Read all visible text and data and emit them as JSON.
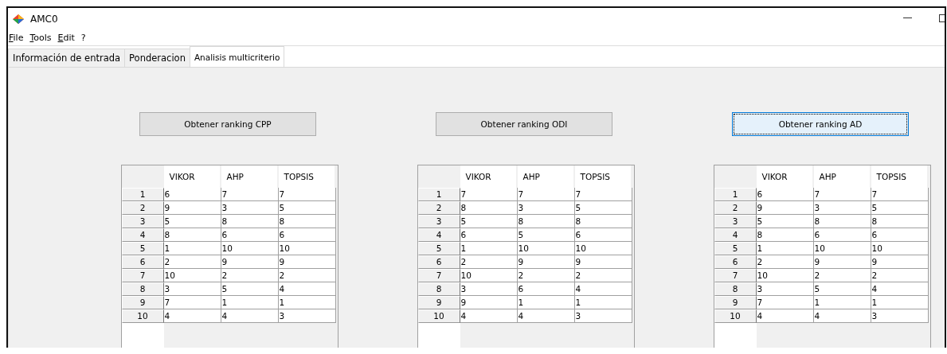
{
  "window": {
    "title": "AMC0"
  },
  "menu": [
    "File",
    "Tools",
    "Edit",
    "?"
  ],
  "tabs": [
    {
      "label": "Información de entrada",
      "selected": false
    },
    {
      "label": "Ponderacion",
      "selected": false
    },
    {
      "label": "Analisis multicriterio",
      "selected": true
    }
  ],
  "panels": [
    {
      "button": {
        "label": "Obtener ranking CPP",
        "focused": false
      },
      "table": {
        "columns": [
          "VIKOR",
          "AHP",
          "TOPSIS"
        ],
        "rows": [
          {
            "header": "1",
            "cells": [
              "6",
              "7",
              "7"
            ]
          },
          {
            "header": "2",
            "cells": [
              "9",
              "3",
              "5"
            ]
          },
          {
            "header": "3",
            "cells": [
              "5",
              "8",
              "8"
            ]
          },
          {
            "header": "4",
            "cells": [
              "8",
              "6",
              "6"
            ]
          },
          {
            "header": "5",
            "cells": [
              "1",
              "10",
              "10"
            ]
          },
          {
            "header": "6",
            "cells": [
              "2",
              "9",
              "9"
            ]
          },
          {
            "header": "7",
            "cells": [
              "10",
              "2",
              "2"
            ]
          },
          {
            "header": "8",
            "cells": [
              "3",
              "5",
              "4"
            ]
          },
          {
            "header": "9",
            "cells": [
              "7",
              "1",
              "1"
            ]
          },
          {
            "header": "10",
            "cells": [
              "4",
              "4",
              "3"
            ]
          }
        ]
      }
    },
    {
      "button": {
        "label": "Obtener ranking ODI",
        "focused": false
      },
      "table": {
        "columns": [
          "VIKOR",
          "AHP",
          "TOPSIS"
        ],
        "rows": [
          {
            "header": "1",
            "cells": [
              "7",
              "7",
              "7"
            ]
          },
          {
            "header": "2",
            "cells": [
              "8",
              "3",
              "5"
            ]
          },
          {
            "header": "3",
            "cells": [
              "5",
              "8",
              "8"
            ]
          },
          {
            "header": "4",
            "cells": [
              "6",
              "5",
              "6"
            ]
          },
          {
            "header": "5",
            "cells": [
              "1",
              "10",
              "10"
            ]
          },
          {
            "header": "6",
            "cells": [
              "2",
              "9",
              "9"
            ]
          },
          {
            "header": "7",
            "cells": [
              "10",
              "2",
              "2"
            ]
          },
          {
            "header": "8",
            "cells": [
              "3",
              "6",
              "4"
            ]
          },
          {
            "header": "9",
            "cells": [
              "9",
              "1",
              "1"
            ]
          },
          {
            "header": "10",
            "cells": [
              "4",
              "4",
              "3"
            ]
          }
        ]
      }
    },
    {
      "button": {
        "label": "Obtener ranking AD",
        "focused": true
      },
      "table": {
        "columns": [
          "VIKOR",
          "AHP",
          "TOPSIS"
        ],
        "rows": [
          {
            "header": "1",
            "cells": [
              "6",
              "7",
              "7"
            ]
          },
          {
            "header": "2",
            "cells": [
              "9",
              "3",
              "5"
            ]
          },
          {
            "header": "3",
            "cells": [
              "5",
              "8",
              "8"
            ]
          },
          {
            "header": "4",
            "cells": [
              "8",
              "6",
              "6"
            ]
          },
          {
            "header": "5",
            "cells": [
              "1",
              "10",
              "10"
            ]
          },
          {
            "header": "6",
            "cells": [
              "2",
              "9",
              "9"
            ]
          },
          {
            "header": "7",
            "cells": [
              "10",
              "2",
              "2"
            ]
          },
          {
            "header": "8",
            "cells": [
              "3",
              "5",
              "4"
            ]
          },
          {
            "header": "9",
            "cells": [
              "7",
              "1",
              "1"
            ]
          },
          {
            "header": "10",
            "cells": [
              "4",
              "4",
              "3"
            ]
          }
        ]
      }
    }
  ]
}
